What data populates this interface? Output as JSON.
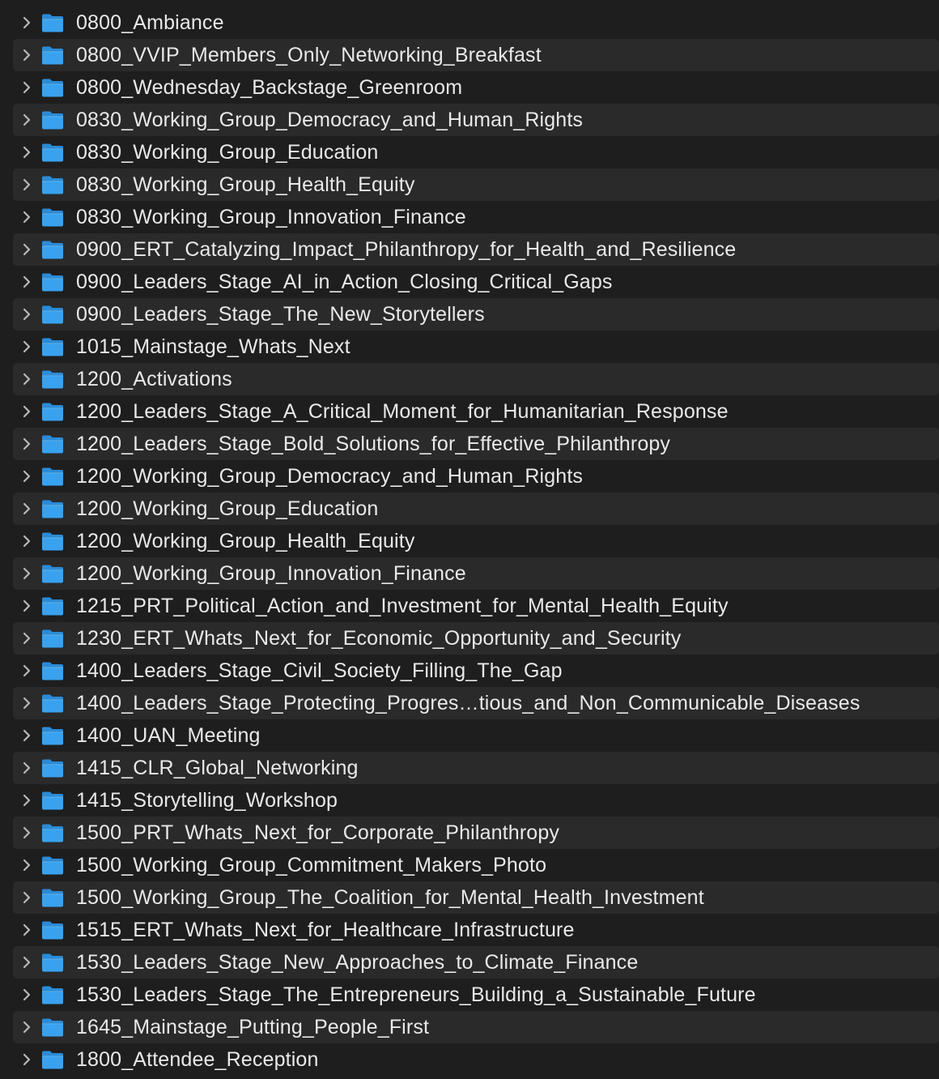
{
  "colors": {
    "background": "#1e1e1e",
    "row_alt": "#2a2a2a",
    "text": "#e9e9e9",
    "folder": "#38a2f0",
    "folder_tab": "#2a8bd8",
    "chevron": "#b8b8b8"
  },
  "icons": {
    "disclosure": "chevron-right-icon",
    "item": "folder-icon"
  },
  "folders": [
    {
      "name": "0800_Ambiance"
    },
    {
      "name": "0800_VVIP_Members_Only_Networking_Breakfast"
    },
    {
      "name": "0800_Wednesday_Backstage_Greenroom"
    },
    {
      "name": "0830_Working_Group_Democracy_and_Human_Rights"
    },
    {
      "name": "0830_Working_Group_Education"
    },
    {
      "name": "0830_Working_Group_Health_Equity"
    },
    {
      "name": "0830_Working_Group_Innovation_Finance"
    },
    {
      "name": "0900_ERT_Catalyzing_Impact_Philanthropy_for_Health_and_Resilience"
    },
    {
      "name": "0900_Leaders_Stage_AI_in_Action_Closing_Critical_Gaps"
    },
    {
      "name": "0900_Leaders_Stage_The_New_Storytellers"
    },
    {
      "name": "1015_Mainstage_Whats_Next"
    },
    {
      "name": "1200_Activations"
    },
    {
      "name": "1200_Leaders_Stage_A_Critical_Moment_for_Humanitarian_Response"
    },
    {
      "name": "1200_Leaders_Stage_Bold_Solutions_for_Effective_Philanthropy"
    },
    {
      "name": "1200_Working_Group_Democracy_and_Human_Rights"
    },
    {
      "name": "1200_Working_Group_Education"
    },
    {
      "name": "1200_Working_Group_Health_Equity"
    },
    {
      "name": "1200_Working_Group_Innovation_Finance"
    },
    {
      "name": "1215_PRT_Political_Action_and_Investment_for_Mental_Health_Equity"
    },
    {
      "name": "1230_ERT_Whats_Next_for_Economic_Opportunity_and_Security"
    },
    {
      "name": "1400_Leaders_Stage_Civil_Society_Filling_The_Gap"
    },
    {
      "name": "1400_Leaders_Stage_Protecting_Progres…tious_and_Non_Communicable_Diseases"
    },
    {
      "name": "1400_UAN_Meeting"
    },
    {
      "name": "1415_CLR_Global_Networking"
    },
    {
      "name": "1415_Storytelling_Workshop"
    },
    {
      "name": "1500_PRT_Whats_Next_for_Corporate_Philanthropy"
    },
    {
      "name": "1500_Working_Group_Commitment_Makers_Photo"
    },
    {
      "name": "1500_Working_Group_The_Coalition_for_Mental_Health_Investment"
    },
    {
      "name": "1515_ERT_Whats_Next_for_Healthcare_Infrastructure"
    },
    {
      "name": "1530_Leaders_Stage_New_Approaches_to_Climate_Finance"
    },
    {
      "name": "1530_Leaders_Stage_The_Entrepreneurs_Building_a_Sustainable_Future"
    },
    {
      "name": "1645_Mainstage_Putting_People_First"
    },
    {
      "name": "1800_Attendee_Reception"
    }
  ]
}
